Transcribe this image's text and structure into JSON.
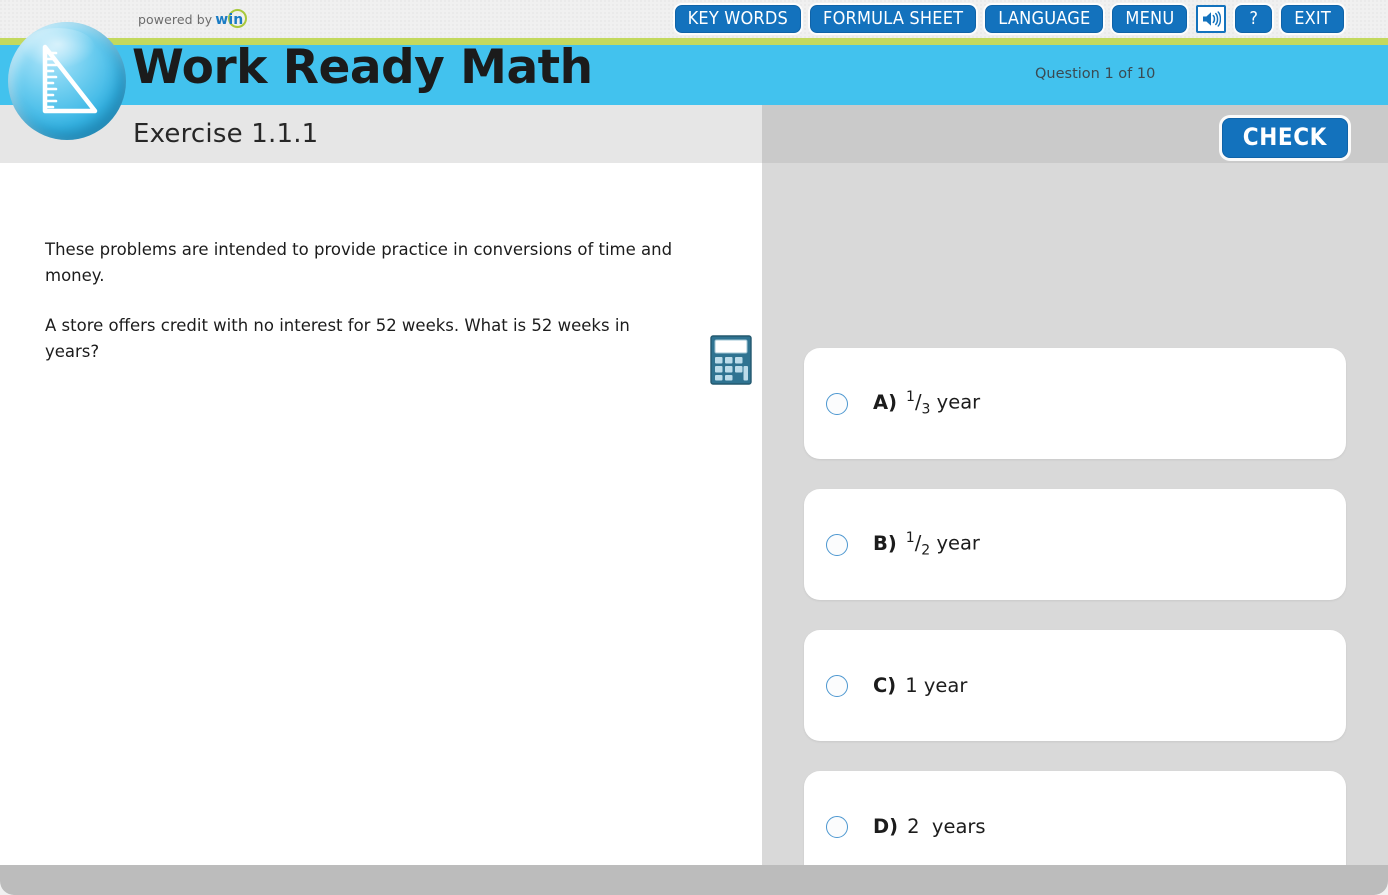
{
  "branding": {
    "powered_by_text": "powered by",
    "powered_by_brand": "win",
    "logo_icon": "ruler-triangle-icon"
  },
  "topbar": {
    "buttons": [
      {
        "label": "KEY WORDS",
        "name": "key-words-button"
      },
      {
        "label": "FORMULA SHEET",
        "name": "formula-sheet-button"
      },
      {
        "label": "LANGUAGE",
        "name": "language-button"
      },
      {
        "label": "MENU",
        "name": "menu-button"
      }
    ],
    "sound_icon": "speaker-icon",
    "help_label": "?",
    "exit_label": "EXIT"
  },
  "header": {
    "app_title": "Work Ready Math",
    "question_counter": "Question 1 of 10"
  },
  "left_panel": {
    "exercise_title": "Exercise 1.1.1",
    "intro_text": "These problems are intended to provide practice in conversions of time and money.",
    "prompt_text": "A store offers credit with no interest for 52 weeks. What is 52 weeks in years?",
    "calculator_icon": "calculator-icon"
  },
  "right_panel": {
    "check_label": "CHECK",
    "options": [
      {
        "letter": "A)",
        "value_num": "1",
        "value_den": "3",
        "unit": "year",
        "is_fraction": true,
        "selected": false
      },
      {
        "letter": "B)",
        "value_num": "1",
        "value_den": "2",
        "unit": "year",
        "is_fraction": true,
        "selected": false
      },
      {
        "letter": "C)",
        "text": "1 year",
        "is_fraction": false,
        "selected": false
      },
      {
        "letter": "D)",
        "text": "2  years",
        "is_fraction": false,
        "selected": false
      }
    ]
  },
  "colors": {
    "brand_blue": "#1372bd",
    "band_cyan": "#42c2ee",
    "band_green": "#c3d95e",
    "right_panel_bg": "#d9d9d9",
    "right_header_bg": "#cacaca",
    "footer_bg": "#bcbcbc"
  }
}
